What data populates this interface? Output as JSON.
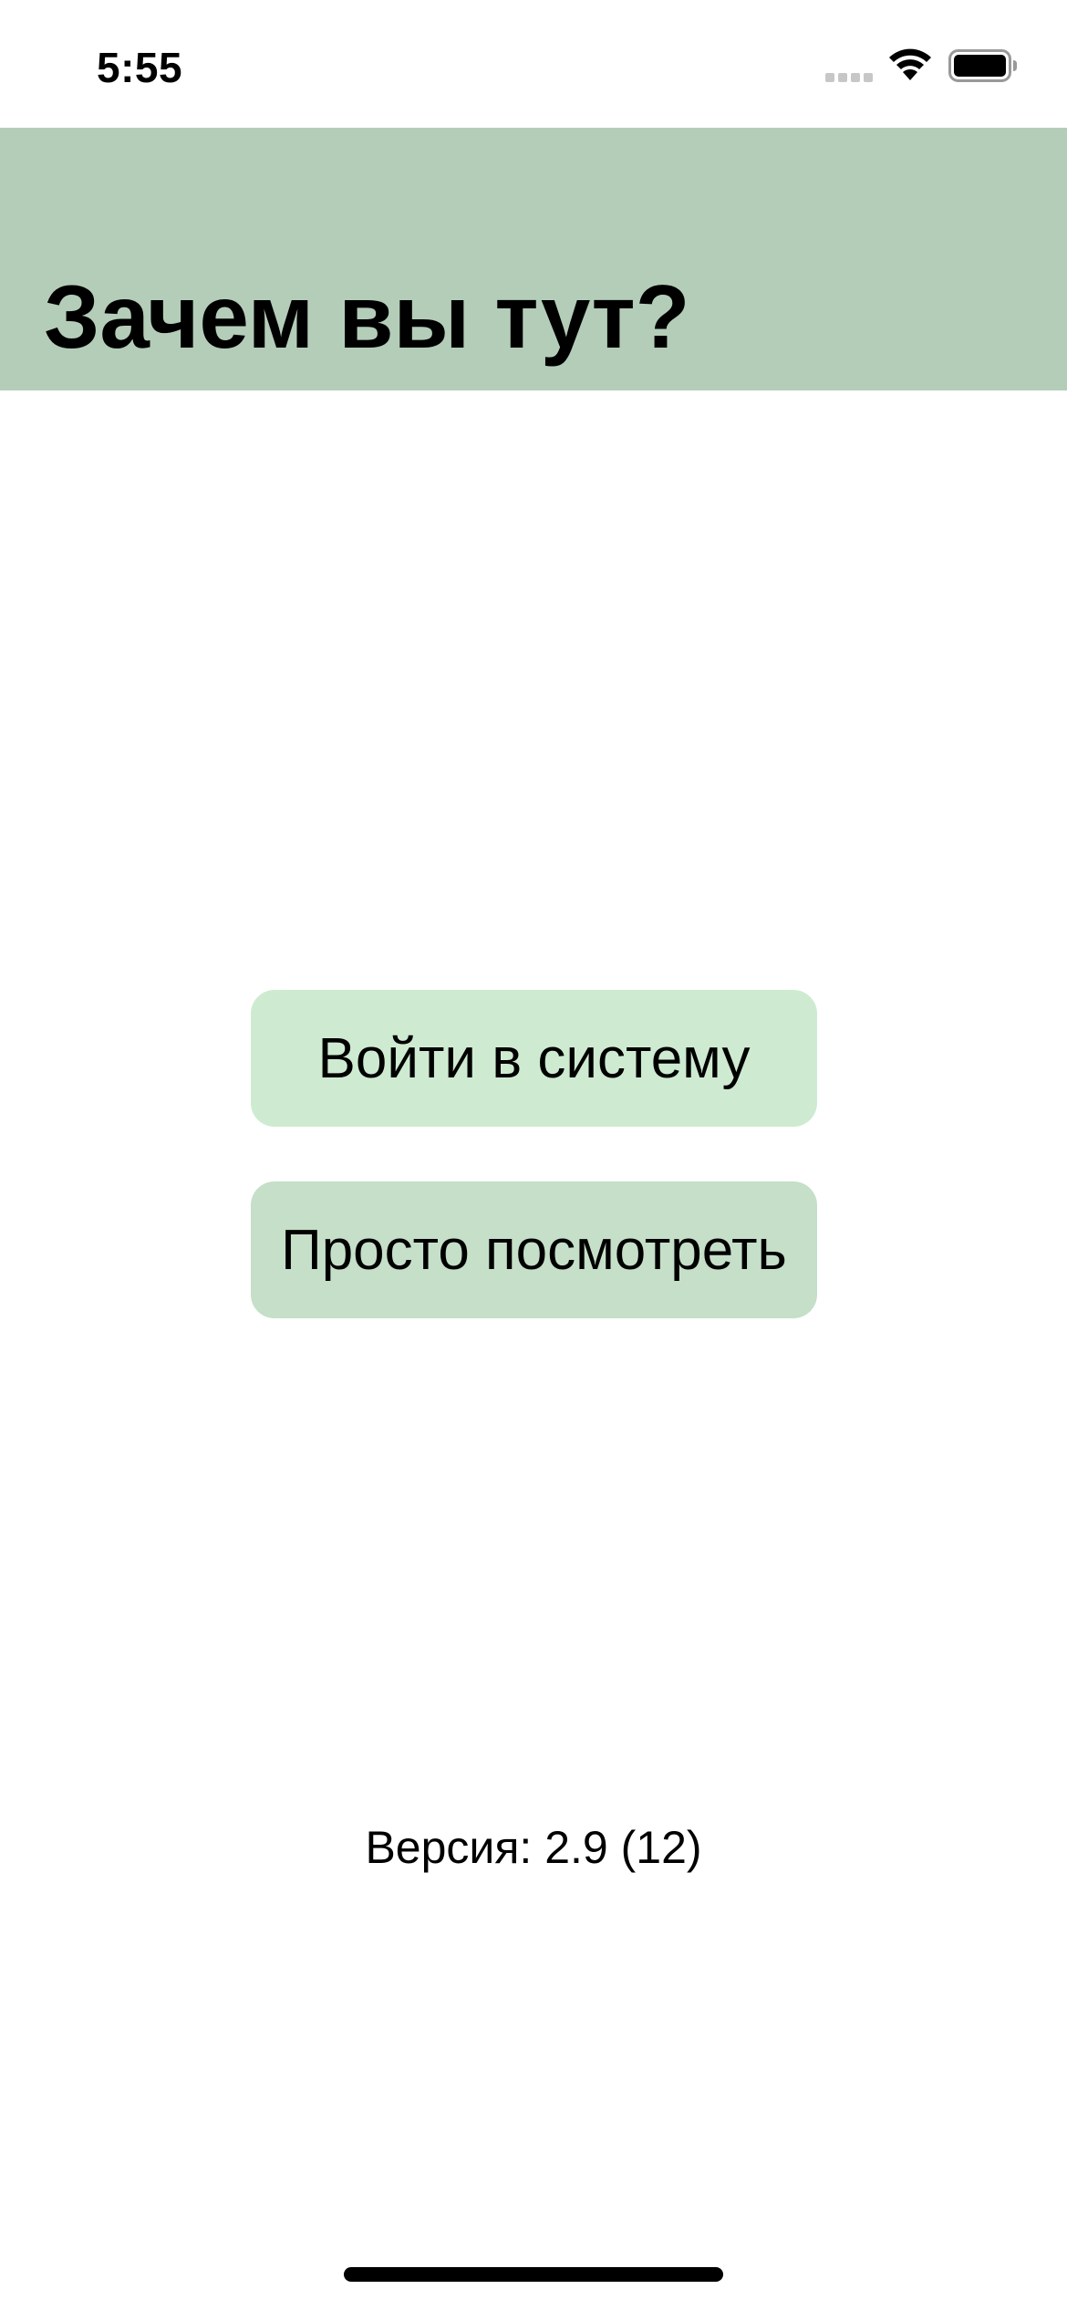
{
  "status_bar": {
    "time": "5:55",
    "icons": [
      "signal-icon",
      "wifi-icon",
      "battery-icon"
    ]
  },
  "header": {
    "title": "Зачем вы тут?",
    "background_color": "#b4cdb9"
  },
  "buttons": {
    "login": {
      "label": "Войти в систему",
      "background_color": "#ceebd1"
    },
    "browse": {
      "label": "Просто посмотреть",
      "background_color": "#c5dfc8"
    }
  },
  "footer": {
    "version": "Версия: 2.9 (12)"
  }
}
